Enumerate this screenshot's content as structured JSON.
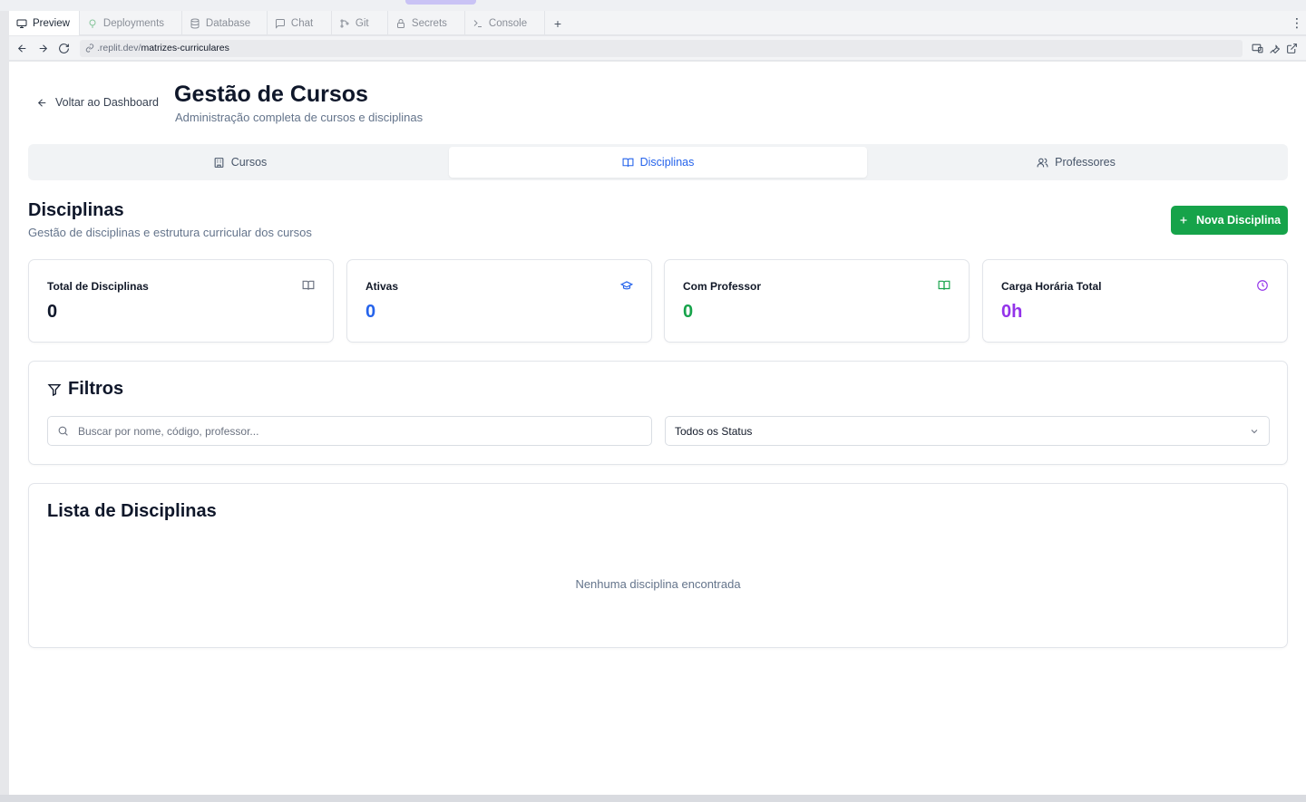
{
  "browser": {
    "tabs": [
      {
        "label": "Preview",
        "icon": "monitor-icon",
        "active": true
      },
      {
        "label": "Deployments",
        "icon": "deploy-icon",
        "active": false
      },
      {
        "label": "Database",
        "icon": "database-icon",
        "active": false
      },
      {
        "label": "Chat",
        "icon": "chat-icon",
        "active": false
      },
      {
        "label": "Git",
        "icon": "git-icon",
        "active": false
      },
      {
        "label": "Secrets",
        "icon": "lock-icon",
        "active": false
      },
      {
        "label": "Console",
        "icon": "terminal-icon",
        "active": false
      }
    ],
    "new_tab": "+",
    "url_domain": ".replit.dev/",
    "url_path": "matrizes-curriculares"
  },
  "header": {
    "back_label": "Voltar ao Dashboard",
    "title": "Gestão de Cursos",
    "subtitle": "Administração completa de cursos e disciplinas"
  },
  "tabs": [
    {
      "label": "Cursos",
      "icon": "building-icon",
      "active": false
    },
    {
      "label": "Disciplinas",
      "icon": "book-icon",
      "active": true
    },
    {
      "label": "Professores",
      "icon": "users-icon",
      "active": false
    }
  ],
  "section": {
    "title": "Disciplinas",
    "subtitle": "Gestão de disciplinas e estrutura curricular dos cursos",
    "new_button": "Nova Disciplina"
  },
  "stats": [
    {
      "label": "Total de Disciplinas",
      "value": "0",
      "color": "#0f172a",
      "icon": "book-open-icon",
      "icon_color": "#6b7280"
    },
    {
      "label": "Ativas",
      "value": "0",
      "color": "#2563eb",
      "icon": "graduation-cap-icon",
      "icon_color": "#2563eb"
    },
    {
      "label": "Com Professor",
      "value": "0",
      "color": "#16a34a",
      "icon": "book-open-icon",
      "icon_color": "#16a34a"
    },
    {
      "label": "Carga Horária Total",
      "value": "0h",
      "color": "#9333ea",
      "icon": "clock-icon",
      "icon_color": "#9333ea"
    }
  ],
  "filters": {
    "title": "Filtros",
    "search_placeholder": "Buscar por nome, código, professor...",
    "status_value": "Todos os Status"
  },
  "list": {
    "title": "Lista de Disciplinas",
    "empty_message": "Nenhuma disciplina encontrada"
  },
  "colors": {
    "accent": "#2563eb",
    "success": "#16a34a",
    "purple": "#9333ea"
  }
}
